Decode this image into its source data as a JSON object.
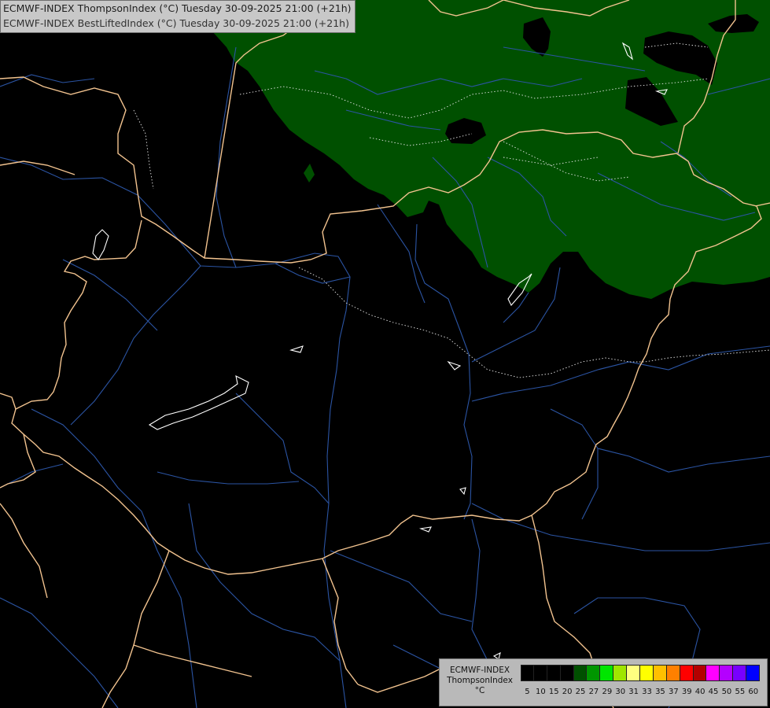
{
  "header": {
    "line1": "ECMWF-INDEX ThompsonIndex (°C) Tuesday 30-09-2025 21:00 (+21h)",
    "line2": "ECMWF-INDEX BestLiftedIndex (°C) Tuesday 30-09-2025 21:00 (+21h)"
  },
  "legend": {
    "model": "ECMWF-INDEX",
    "parameter": "ThompsonIndex",
    "unit": "°C",
    "ticks": [
      "5",
      "10",
      "15",
      "20",
      "25",
      "27",
      "29",
      "30",
      "31",
      "33",
      "35",
      "37",
      "39",
      "40",
      "45",
      "50",
      "55",
      "60"
    ],
    "colors": [
      "#000000",
      "#000000",
      "#000000",
      "#000000",
      "#005000",
      "#009600",
      "#00e600",
      "#a0e600",
      "#ffff80",
      "#ffff00",
      "#ffc000",
      "#ff8000",
      "#ff0000",
      "#b40000",
      "#ff00ff",
      "#b400ff",
      "#7800ff",
      "#0000ff"
    ]
  },
  "map": {
    "background_color": "#000000",
    "field_color": "#005000",
    "border_color": "#f2c38f",
    "river_color": "#2b54a3",
    "lake_color": "#ffffff"
  }
}
